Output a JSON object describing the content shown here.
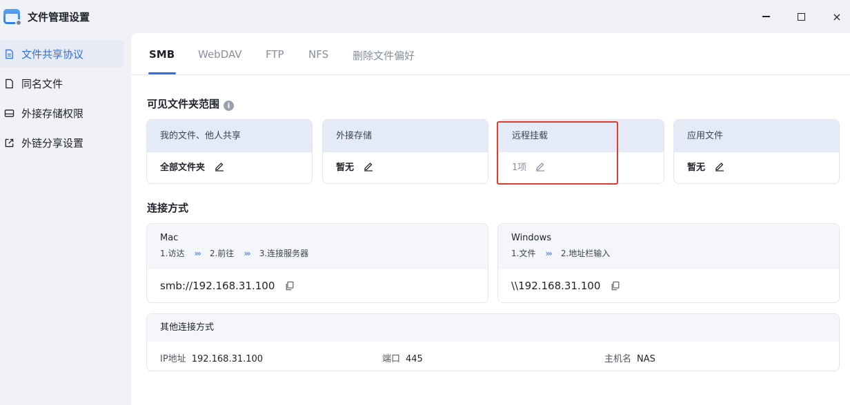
{
  "window": {
    "title": "文件管理设置",
    "minimize": "−",
    "maximize": "□",
    "close": "×"
  },
  "sidebar": {
    "items": [
      {
        "label": "文件共享协议",
        "icon": "document-icon",
        "active": true
      },
      {
        "label": "同名文件",
        "icon": "file-icon",
        "active": false
      },
      {
        "label": "外接存储权限",
        "icon": "drive-icon",
        "active": false
      },
      {
        "label": "外链分享设置",
        "icon": "share-icon",
        "active": false
      }
    ]
  },
  "tabs": [
    {
      "label": "SMB",
      "active": true
    },
    {
      "label": "WebDAV",
      "active": false
    },
    {
      "label": "FTP",
      "active": false
    },
    {
      "label": "NFS",
      "active": false
    },
    {
      "label": "删除文件偏好",
      "active": false
    }
  ],
  "visible_scope": {
    "title": "可见文件夹范围",
    "info_glyph": "i",
    "cards": [
      {
        "header": "我的文件、他人共享",
        "value": "全部文件夹"
      },
      {
        "header": "外接存储",
        "value": "暂无"
      },
      {
        "header": "远程挂载",
        "value": "1项"
      },
      {
        "header": "应用文件",
        "value": "暂无"
      }
    ]
  },
  "connection": {
    "title": "连接方式",
    "mac": {
      "os": "Mac",
      "steps": [
        "1.访达",
        "2.前往",
        "3.连接服务器"
      ],
      "arrow": "›››",
      "address": "smb://192.168.31.100"
    },
    "windows": {
      "os": "Windows",
      "steps": [
        "1.文件",
        "2.地址栏输入"
      ],
      "arrow": "›››",
      "address": "\\\\192.168.31.100"
    },
    "other": {
      "title": "其他连接方式",
      "ip_label": "IP地址",
      "ip_value": "192.168.31.100",
      "port_label": "端口",
      "port_value": "445",
      "host_label": "主机名",
      "host_value": "NAS"
    }
  },
  "colors": {
    "accent": "#2f6fe5",
    "highlight_box": "#e03a2f"
  }
}
